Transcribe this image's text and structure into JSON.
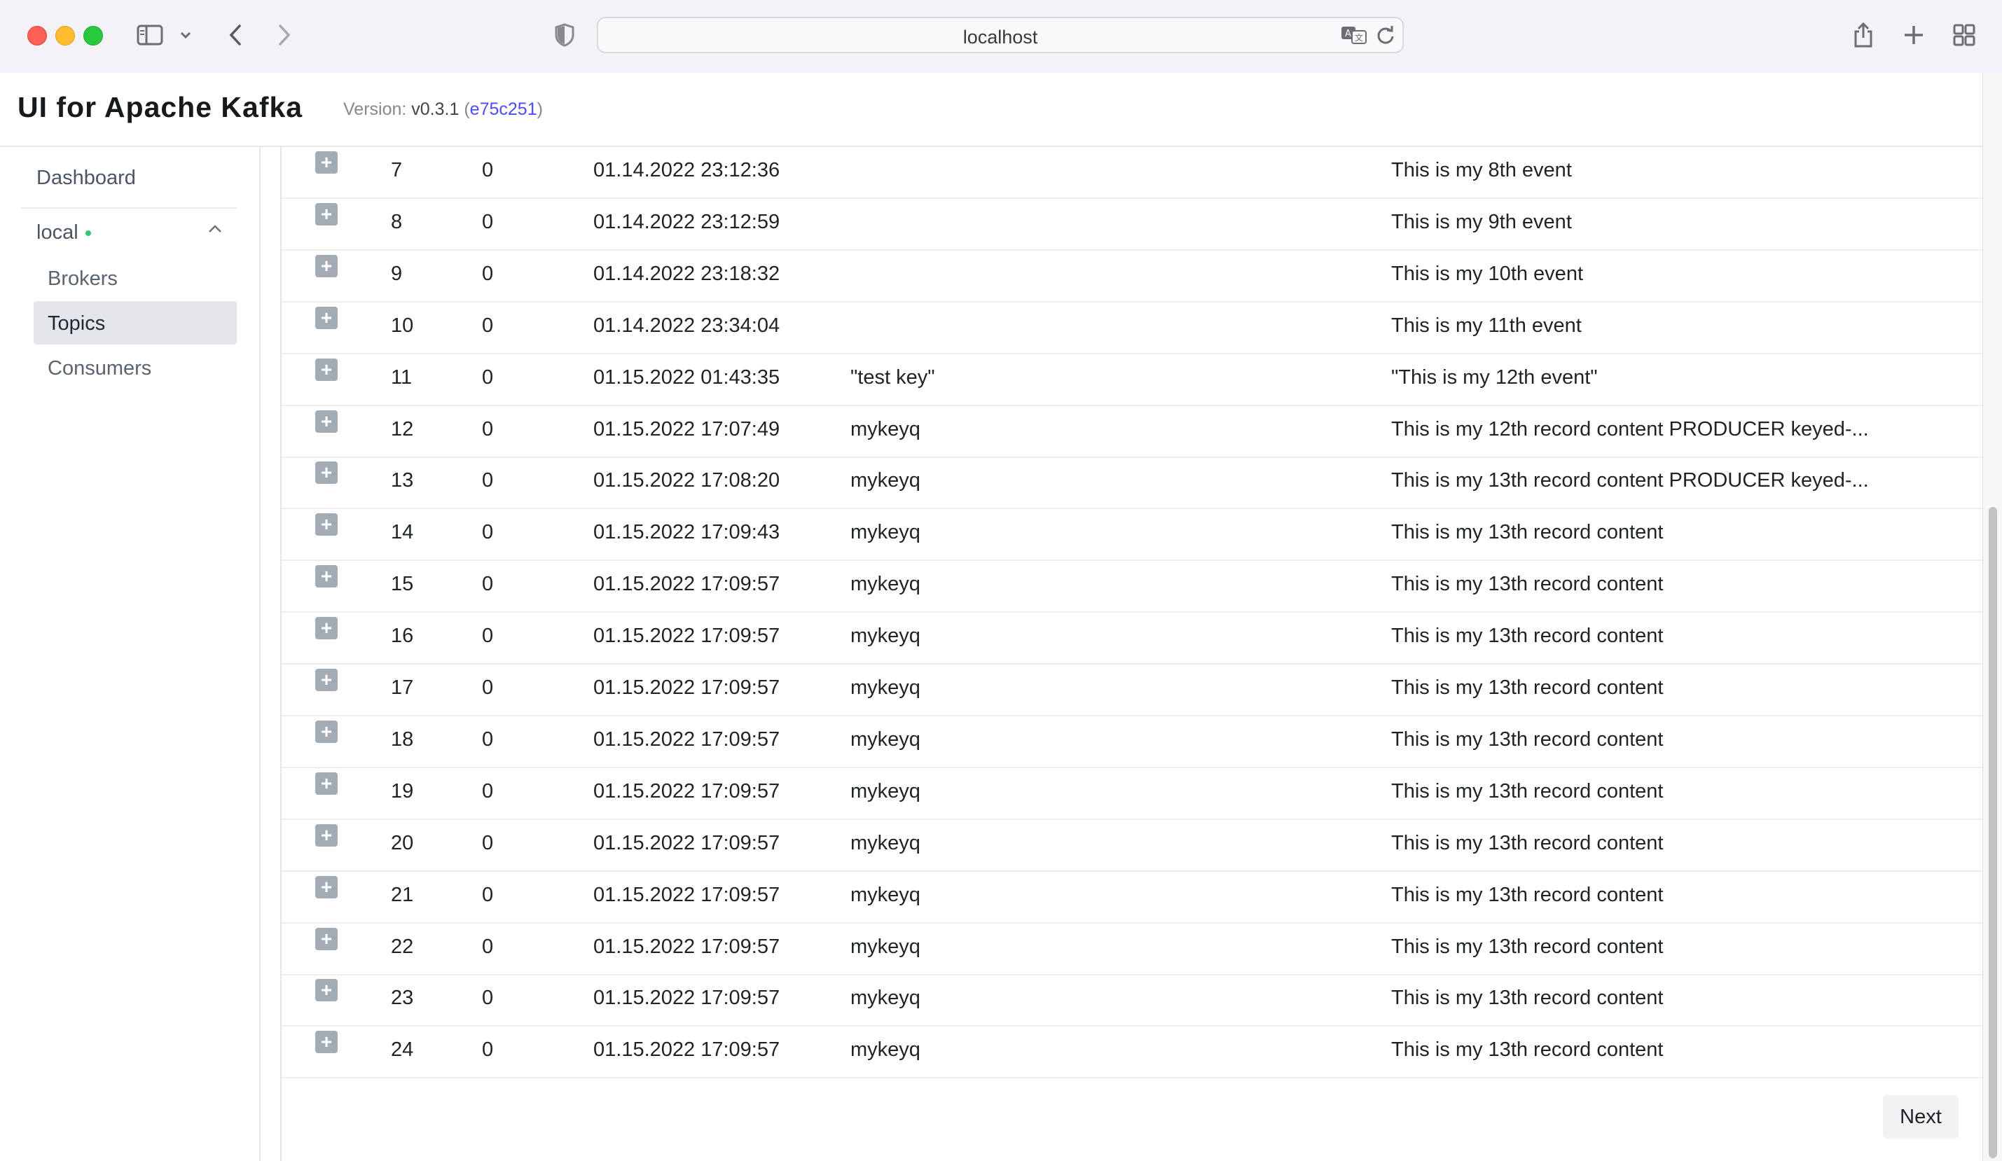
{
  "browser": {
    "url": "localhost"
  },
  "app": {
    "title": "UI for Apache Kafka",
    "version_label": "Version: ",
    "version_number": "v0.3.1",
    "commit_open": "(",
    "commit": "e75c251",
    "commit_close": ")"
  },
  "sidebar": {
    "dashboard": "Dashboard",
    "cluster": "local",
    "items": [
      {
        "label": "Brokers"
      },
      {
        "label": "Topics",
        "active": true
      },
      {
        "label": "Consumers"
      }
    ]
  },
  "messages": [
    {
      "offset": "7",
      "partition": "0",
      "timestamp": "01.14.2022 23:12:36",
      "key": "",
      "content": "This is my 8th event"
    },
    {
      "offset": "8",
      "partition": "0",
      "timestamp": "01.14.2022 23:12:59",
      "key": "",
      "content": "This is my 9th event"
    },
    {
      "offset": "9",
      "partition": "0",
      "timestamp": "01.14.2022 23:18:32",
      "key": "",
      "content": "This is my 10th event"
    },
    {
      "offset": "10",
      "partition": "0",
      "timestamp": "01.14.2022 23:34:04",
      "key": "",
      "content": "This is my 11th event"
    },
    {
      "offset": "11",
      "partition": "0",
      "timestamp": "01.15.2022 01:43:35",
      "key": "\"test key\"",
      "content": "\"This is my 12th event\""
    },
    {
      "offset": "12",
      "partition": "0",
      "timestamp": "01.15.2022 17:07:49",
      "key": "mykeyq",
      "content": "This is my 12th record content PRODUCER keyed-..."
    },
    {
      "offset": "13",
      "partition": "0",
      "timestamp": "01.15.2022 17:08:20",
      "key": "mykeyq",
      "content": "This is my 13th record content PRODUCER keyed-..."
    },
    {
      "offset": "14",
      "partition": "0",
      "timestamp": "01.15.2022 17:09:43",
      "key": "mykeyq",
      "content": "This is my 13th record content"
    },
    {
      "offset": "15",
      "partition": "0",
      "timestamp": "01.15.2022 17:09:57",
      "key": "mykeyq",
      "content": "This is my 13th record content"
    },
    {
      "offset": "16",
      "partition": "0",
      "timestamp": "01.15.2022 17:09:57",
      "key": "mykeyq",
      "content": "This is my 13th record content"
    },
    {
      "offset": "17",
      "partition": "0",
      "timestamp": "01.15.2022 17:09:57",
      "key": "mykeyq",
      "content": "This is my 13th record content"
    },
    {
      "offset": "18",
      "partition": "0",
      "timestamp": "01.15.2022 17:09:57",
      "key": "mykeyq",
      "content": "This is my 13th record content"
    },
    {
      "offset": "19",
      "partition": "0",
      "timestamp": "01.15.2022 17:09:57",
      "key": "mykeyq",
      "content": "This is my 13th record content"
    },
    {
      "offset": "20",
      "partition": "0",
      "timestamp": "01.15.2022 17:09:57",
      "key": "mykeyq",
      "content": "This is my 13th record content"
    },
    {
      "offset": "21",
      "partition": "0",
      "timestamp": "01.15.2022 17:09:57",
      "key": "mykeyq",
      "content": "This is my 13th record content"
    },
    {
      "offset": "22",
      "partition": "0",
      "timestamp": "01.15.2022 17:09:57",
      "key": "mykeyq",
      "content": "This is my 13th record content"
    },
    {
      "offset": "23",
      "partition": "0",
      "timestamp": "01.15.2022 17:09:57",
      "key": "mykeyq",
      "content": "This is my 13th record content"
    },
    {
      "offset": "24",
      "partition": "0",
      "timestamp": "01.15.2022 17:09:57",
      "key": "mykeyq",
      "content": "This is my 13th record content"
    }
  ],
  "pagination": {
    "next_label": "Next"
  }
}
